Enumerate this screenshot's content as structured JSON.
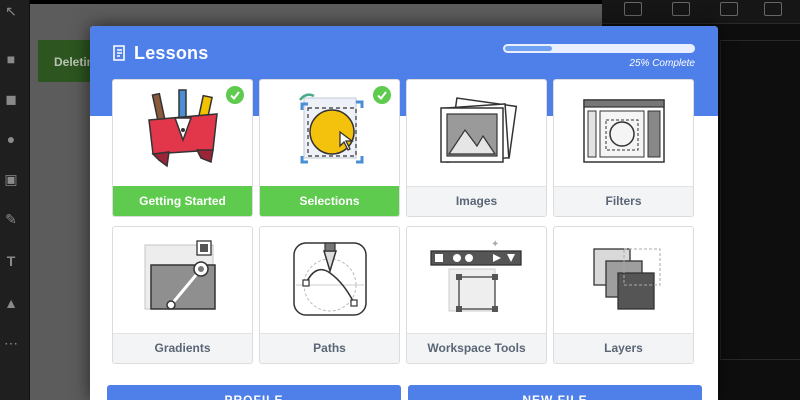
{
  "background": {
    "banner_text": "Deleting"
  },
  "modal": {
    "title": "Lessons",
    "progress_text": "25% Complete",
    "progress_fraction": 0.25,
    "accent_color": "#4f7fe8",
    "done_color": "#5ecb4f"
  },
  "lessons": [
    {
      "label": "Getting Started",
      "completed": true,
      "icon": "pens-banner-icon"
    },
    {
      "label": "Selections",
      "completed": true,
      "icon": "selection-cursor-icon"
    },
    {
      "label": "Images",
      "completed": false,
      "icon": "image-stack-icon"
    },
    {
      "label": "Filters",
      "completed": false,
      "icon": "filter-window-icon"
    },
    {
      "label": "Gradients",
      "completed": false,
      "icon": "gradient-tool-icon"
    },
    {
      "label": "Paths",
      "completed": false,
      "icon": "pen-path-icon"
    },
    {
      "label": "Workspace Tools",
      "completed": false,
      "icon": "workspace-tools-icon"
    },
    {
      "label": "Layers",
      "completed": false,
      "icon": "layers-icon"
    }
  ],
  "footer": {
    "profile_label": "PROFILE",
    "new_file_label": "NEW FILE"
  }
}
